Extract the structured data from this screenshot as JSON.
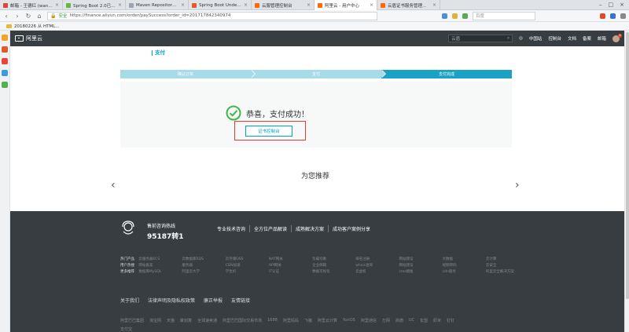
{
  "browser": {
    "tabs": [
      {
        "label": "邮箱 - 王德红 (wangjhu...",
        "color": "#d9453a"
      },
      {
        "label": "Spring Boot 2.0已发布...",
        "color": "#6db33f"
      },
      {
        "label": "Maven Repository: o...",
        "color": "#9aa5b1"
      },
      {
        "label": "Spring Boot Undertow...",
        "color": "#e05a2b"
      },
      {
        "label": "云服管理控制台",
        "color": "#ff6a00"
      },
      {
        "label": "阿里云 - 用户中心",
        "color": "#ff6a00",
        "active": true
      },
      {
        "label": "云盾证书服务管理控制台",
        "color": "#ff6a00"
      }
    ],
    "secure_label": "安全",
    "url": "https://finance.aliyun.com/order/paySuccess?order_id=201717842340974",
    "search_placeholder": "百度",
    "bookmark": "20180226 从 HTML..."
  },
  "header": {
    "logo_text": "阿里云",
    "search_placeholder": "云盾",
    "site": "中国站",
    "nav": [
      "控制台",
      "文档",
      "备案",
      "邮箱"
    ],
    "badge": "5"
  },
  "page": {
    "title": "支付",
    "steps": [
      "确认订单",
      "支付",
      "支付完成"
    ],
    "success_message": "恭喜，支付成功！",
    "cert_button": "证书控制台",
    "recommend_title": "为您推荐",
    "prev": "‹",
    "next": "›"
  },
  "footer": {
    "hotline_label": "售前咨询热线",
    "hotline_number": "95187转1",
    "links": [
      "专业技术咨询",
      "全方位产品解读",
      "成熟解决方案",
      "成功客户案例分享"
    ],
    "grid": [
      {
        "category": "热门产品",
        "items": [
          "云服务器ECS",
          "云数据库RDS",
          "云存储OSS",
          "NAT网关",
          "负载均衡",
          "域名注册",
          "网站建设",
          "大数据",
          "云计算"
        ]
      },
      {
        "category": "用户热搜",
        "items": [
          "网站备案",
          "服务器",
          "CDN加速",
          "API网关",
          "企业邮箱",
          "whois查询",
          "网站建设",
          "视频转码",
          "云安全"
        ]
      },
      {
        "category": "更多推荐",
        "items": [
          "数据库MySQL",
          "阿里云大学",
          "学生机",
          "IT认证",
          "数据可视化",
          "云虚机",
          "cms模板",
          "cdn服务",
          "阿里云全解决方案"
        ]
      }
    ],
    "bottom_links": [
      "关于我们",
      "法律声明及隐私权政策",
      "廉正举报",
      "友情链接"
    ],
    "partners": [
      "阿里巴巴集团",
      "淘宝网",
      "天猫",
      "聚划算",
      "全球速卖通",
      "阿里巴巴国际交易市场",
      "1688",
      "阿里妈妈",
      "飞猪",
      "阿里云计算",
      "YunOS",
      "阿里通信",
      "万网",
      "高德",
      "UC",
      "友盟",
      "虾米",
      "钉钉"
    ],
    "partners2": "支付宝"
  }
}
